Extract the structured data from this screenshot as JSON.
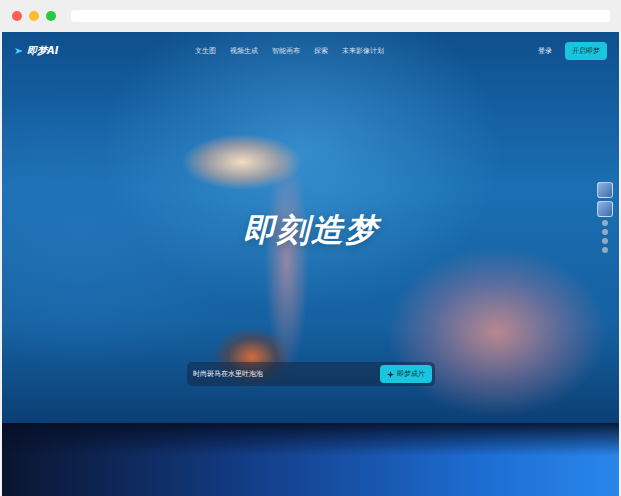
{
  "logo": "即梦AI",
  "nav": [
    "文生图",
    "视频生成",
    "智能画布",
    "探索",
    "未来影像计划"
  ],
  "login": "登录",
  "cta": "开启即梦",
  "hero": {
    "title": "即刻造梦",
    "prompt": {
      "value": "时尚斑马在水里吐泡泡",
      "button": "即梦成片"
    }
  }
}
